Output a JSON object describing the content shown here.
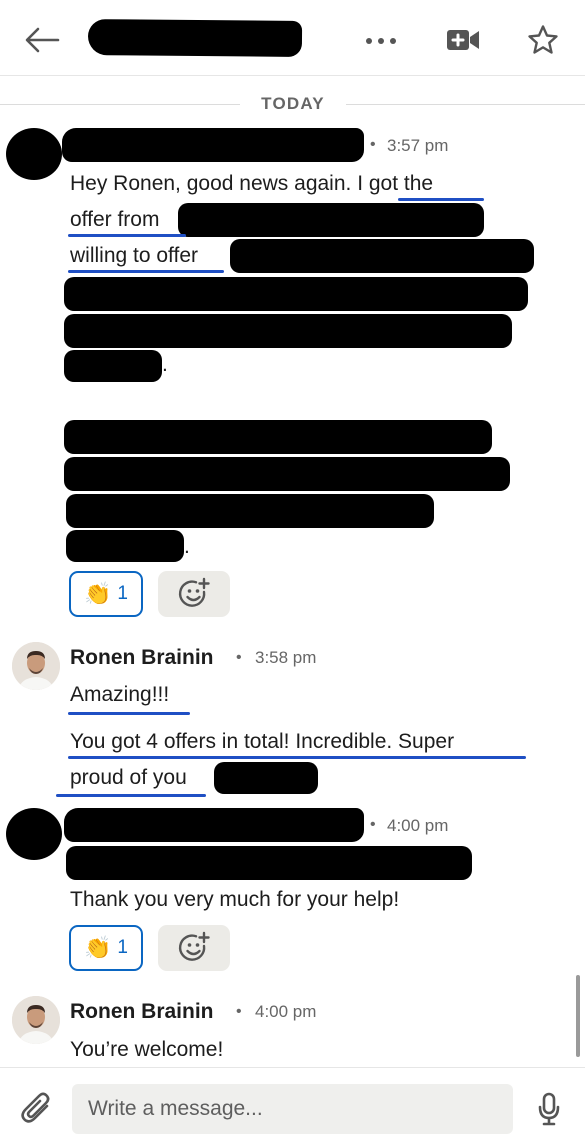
{
  "header": {
    "back_icon": "arrow-left-icon",
    "more_icon": "ellipsis-icon",
    "video_icon": "video-plus-icon",
    "star_icon": "star-outline-icon"
  },
  "divider": {
    "label": "TODAY"
  },
  "messages": [
    {
      "time": "3:57 pm",
      "lines": [
        "Hey Ronen, good news again. I got the",
        "offer from",
        "willing to offer"
      ],
      "trailing_dots": [
        ".",
        "."
      ],
      "reaction": {
        "emoji": "👏",
        "count": "1"
      }
    },
    {
      "sender": "Ronen Brainin",
      "time": "3:58 pm",
      "lines": [
        "Amazing!!!",
        "You got 4 offers in total! Incredible. Super",
        "proud of you"
      ]
    },
    {
      "time": "4:00 pm",
      "lines": [
        "Thank you very much for your help!"
      ],
      "reaction": {
        "emoji": "👏",
        "count": "1"
      }
    },
    {
      "sender": "Ronen Brainin",
      "time": "4:00 pm",
      "lines": [
        "You’re welcome!"
      ]
    }
  ],
  "composer": {
    "placeholder": "Write a message...",
    "attach_icon": "paperclip-icon",
    "mic_icon": "microphone-icon"
  },
  "colors": {
    "accent": "#0a66c2",
    "annotation_underline": "#1f4fc4",
    "redaction": "#000000"
  }
}
